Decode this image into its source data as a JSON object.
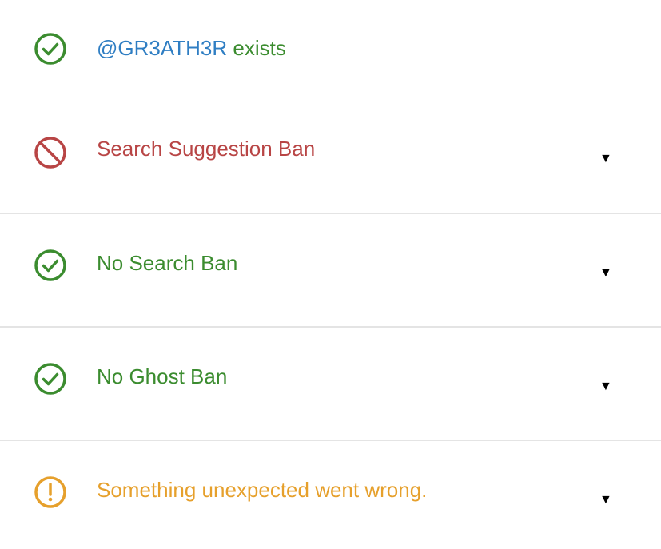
{
  "colors": {
    "success": "#3b8c2f",
    "error": "#b84545",
    "warning": "#e6a02c",
    "handle": "#2f7ec3"
  },
  "checks": {
    "exists": {
      "icon": "check-circle-icon",
      "handle": "@GR3ATH3R",
      "text": " exists"
    },
    "search_suggestion_ban": {
      "icon": "prohibited-icon",
      "text": "Search Suggestion Ban",
      "caret": "▼"
    },
    "search_ban": {
      "icon": "check-circle-icon",
      "text": "No Search Ban",
      "caret": "▼"
    },
    "ghost_ban": {
      "icon": "check-circle-icon",
      "text": "No Ghost Ban",
      "caret": "▼"
    },
    "reply_deboosting": {
      "icon": "exclamation-circle-icon",
      "text": "Something unexpected went wrong.",
      "caret": "▼"
    }
  }
}
